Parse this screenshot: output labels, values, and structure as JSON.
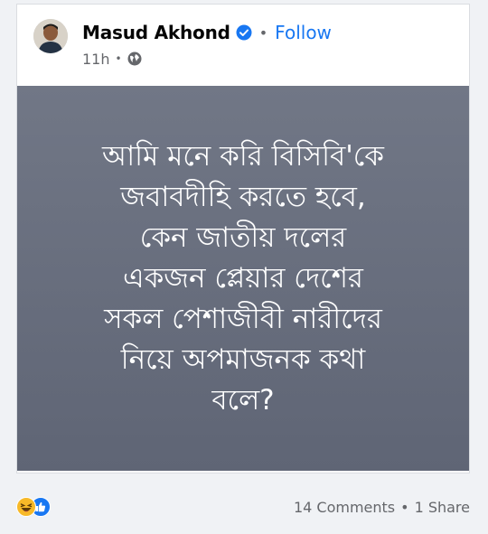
{
  "post": {
    "author": "Masud Akhond",
    "follow_label": "Follow",
    "separator": "•",
    "time": "11h",
    "privacy_icon": "globe-icon",
    "verified_icon": "verified-badge-icon",
    "text_lines": [
      "আমি মনে করি বিসিবি'কে",
      "জবাবদীহি করতে হবে,",
      "কেন জাতীয় দলের",
      "একজন প্লেয়ার দেশের",
      "সকল পেশাজীবী নারীদের",
      "নিয়ে অপমাজনক কথা",
      "বলে?"
    ]
  },
  "footer": {
    "reactions": [
      "laugh-reaction-icon",
      "like-reaction-icon"
    ],
    "comments": "14 Comments",
    "separator": "•",
    "shares": "1 Share"
  },
  "colors": {
    "accent": "#1877f2",
    "post_background": "#6a7080",
    "text_secondary": "#65676b"
  }
}
